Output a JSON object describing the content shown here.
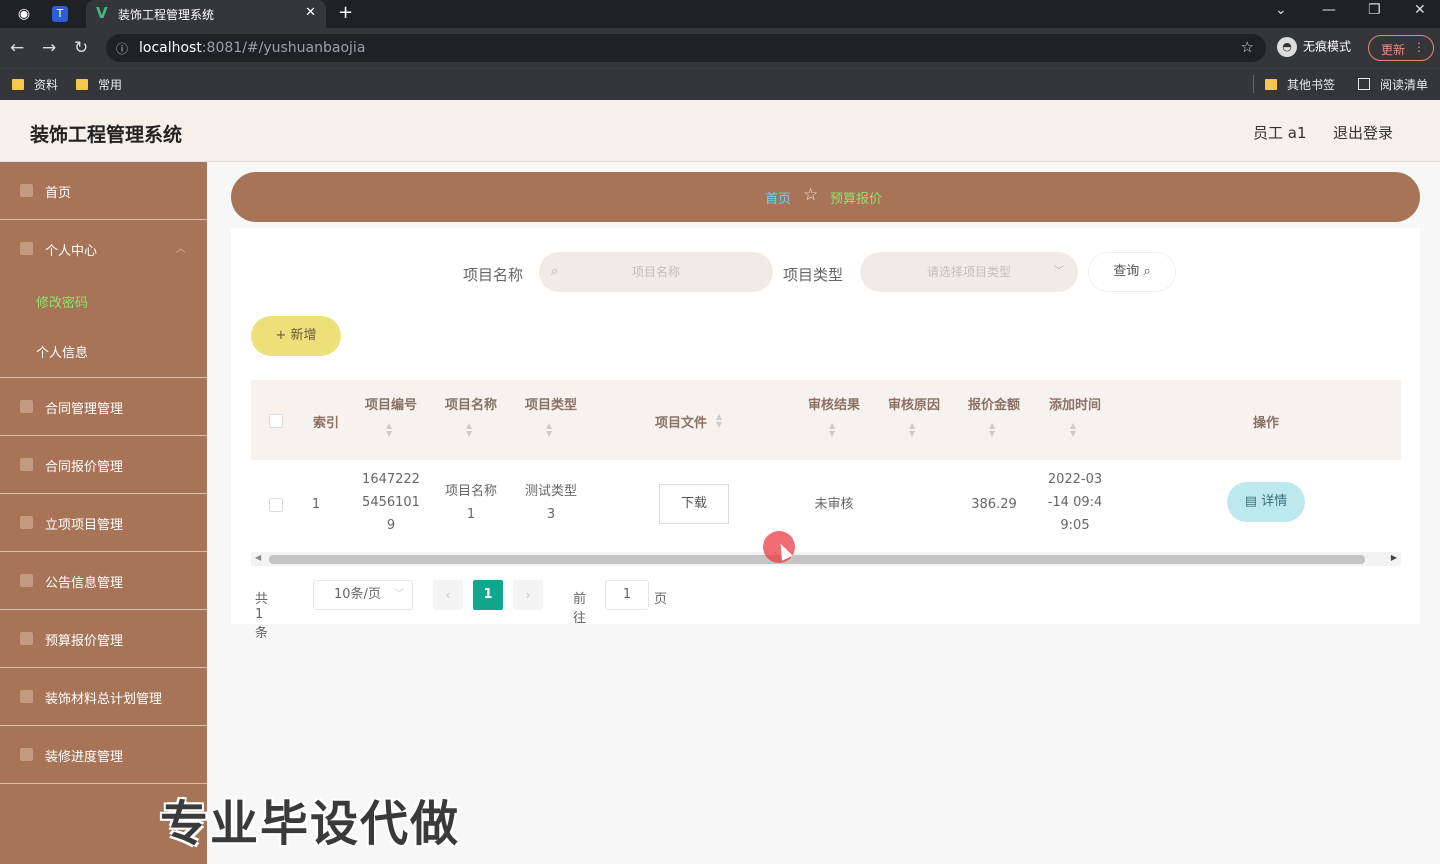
{
  "browser": {
    "tab_title": "装饰工程管理系统",
    "url_host": "localhost",
    "url_rest": ":8081/#/yushuanbaojia",
    "incognito_label": "无痕模式",
    "update_label": "更新",
    "bookmarks": [
      "资料",
      "常用"
    ],
    "other_bookmarks": "其他书签",
    "reading_list": "阅读清单"
  },
  "header": {
    "title": "装饰工程管理系统",
    "user": "员工 a1",
    "logout": "退出登录"
  },
  "sidebar": {
    "items": [
      {
        "label": "首页"
      },
      {
        "label": "个人中心"
      },
      {
        "label": "合同管理管理"
      },
      {
        "label": "合同报价管理"
      },
      {
        "label": "立项项目管理"
      },
      {
        "label": "公告信息管理"
      },
      {
        "label": "预算报价管理"
      },
      {
        "label": "装饰材料总计划管理"
      },
      {
        "label": "装修进度管理"
      }
    ],
    "sub_items": [
      {
        "label": "修改密码"
      },
      {
        "label": "个人信息"
      }
    ]
  },
  "breadcrumb": {
    "home": "首页",
    "current": "预算报价"
  },
  "search": {
    "name_label": "项目名称",
    "name_placeholder": "项目名称",
    "type_label": "项目类型",
    "type_placeholder": "请选择项目类型",
    "query_label": "查询",
    "add_label": "新增"
  },
  "table": {
    "headers": [
      "索引",
      "项目编号",
      "项目名称",
      "项目类型",
      "项目文件",
      "审核结果",
      "审核原因",
      "报价金额",
      "添加时间",
      "操作"
    ],
    "rows": [
      {
        "index": "1",
        "code": [
          "1647222",
          "5456101",
          "9"
        ],
        "name": [
          "项目名称",
          "1"
        ],
        "type": [
          "测试类型",
          "3"
        ],
        "file_button": "下载",
        "review_result": "未审核",
        "review_reason": "",
        "amount": "386.29",
        "time": [
          "2022-03",
          "-14 09:4",
          "9:05"
        ],
        "action": "详情"
      }
    ]
  },
  "pagination": {
    "total": "共 1 条",
    "page_size": "10条/页",
    "current": "1",
    "goto_label": "前往",
    "goto_value": "1",
    "unit": "页"
  },
  "watermark": "专业毕设代做"
}
